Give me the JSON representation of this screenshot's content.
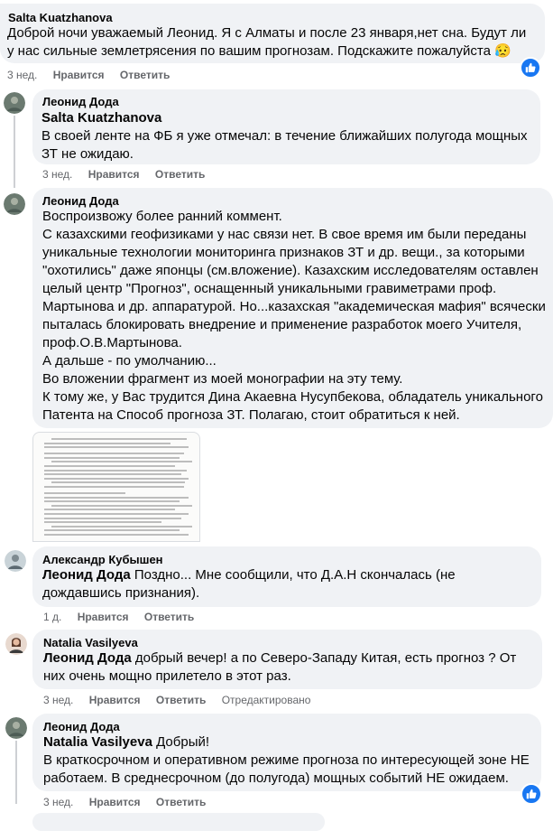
{
  "comments": [
    {
      "author": "Salta Kuatzhanova",
      "lines": [
        "Доброй ночи уважаемый Леонид. Я с Алматы и после 23 января,нет сна. Будут ли",
        "у нас сильные землетрясения по вашим прогнозам. Подскажите пожалуйста 😥"
      ],
      "time": "3 нед.",
      "like": "Нравится",
      "reply": "Ответить"
    },
    {
      "author": "Леонид Дода",
      "mention": "Salta Kuatzhanova",
      "lines": [
        "В своей ленте на ФБ я уже отмечал: в течение ближайших полугода мощных",
        "ЗТ не ожидаю."
      ],
      "time": "3 нед.",
      "like": "Нравится",
      "reply": "Ответить"
    },
    {
      "author": "Леонид Дода",
      "lines": [
        "Воспроизвожу более ранний коммент.",
        "С казахскими геофизиками у нас связи нет. В свое время им были переданы",
        "уникальные технологии мониторинга признаков ЗТ и др. вещи., за которыми",
        "\"охотились\" даже японцы (см.вложение). Казахским исследователям оставлен",
        "целый центр \"Прогноз\", оснащенный уникальными гравиметрами проф.",
        "Мартынова и др. аппаратурой. Но...казахская \"академическая мафия\" всячески",
        "пыталась блокировать внедрение и применение разработок моего Учителя,",
        "проф.О.В.Мартынова.",
        "А дальше - по умолчанию...",
        "Во вложении фрагмент из моей монографии на эту тему.",
        "К тому же, у Вас трудится Дина Акаевна Нусупбекова, обладатель уникального",
        "Патента на Способ прогноза ЗТ. Полагаю, стоит обратиться к ней."
      ]
    },
    {
      "author": "Александр Кубышен",
      "mention": "Леонид Дода",
      "line1_rest": " Поздно... Мне сообщили, что Д.А.Н скончалась (не",
      "line2": "дождавшись признания).",
      "time": "1 д.",
      "like": "Нравится",
      "reply": "Ответить"
    },
    {
      "author": "Natalia Vasilyeva",
      "mention": "Леонид Дода",
      "line1_rest": " добрый вечер! а по Северо-Западу Китая, есть прогноз ? От",
      "line2": "них очень мощно прилетело в этот раз.",
      "time": "3 нед.",
      "like": "Нравится",
      "reply": "Ответить",
      "edited": "Отредактировано"
    },
    {
      "author": "Леонид Дода",
      "mention": "Natalia Vasilyeva",
      "line1_rest": " Добрый!",
      "lines": [
        "В краткосрочном и оперативном режиме прогноза по интересующей зоне НЕ",
        "работаем. В среднесрочном (до полугода) мощных событий НЕ ожидаем."
      ],
      "time": "3 нед.",
      "like": "Нравится",
      "reply": "Ответить"
    }
  ],
  "colors": {
    "bubble": "#f0f2f5",
    "meta": "#65676b",
    "like_blue": "#1877f2"
  },
  "icons": {
    "like": "thumbs-up-icon",
    "sad_emoji": "😥"
  }
}
